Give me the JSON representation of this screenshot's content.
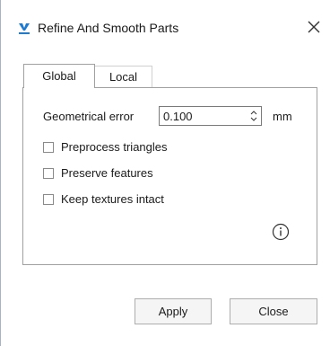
{
  "window": {
    "title": "Refine And Smooth Parts",
    "app_icon": "app-logo-icon",
    "close_icon": "close-icon"
  },
  "tabs": [
    {
      "label": "Global",
      "selected": true
    },
    {
      "label": "Local",
      "selected": false
    }
  ],
  "global": {
    "geometrical_error": {
      "label": "Geometrical error",
      "value": "0.100",
      "unit": "mm"
    },
    "options": [
      {
        "label": "Preprocess triangles",
        "checked": false
      },
      {
        "label": "Preserve features",
        "checked": false
      },
      {
        "label": "Keep textures intact",
        "checked": false
      }
    ],
    "info_icon": "info-icon"
  },
  "buttons": {
    "apply": "Apply",
    "close": "Close"
  },
  "colors": {
    "accent": "#1e7bd0",
    "border": "#a0a0a0",
    "button_bg": "#f5f5f5"
  }
}
